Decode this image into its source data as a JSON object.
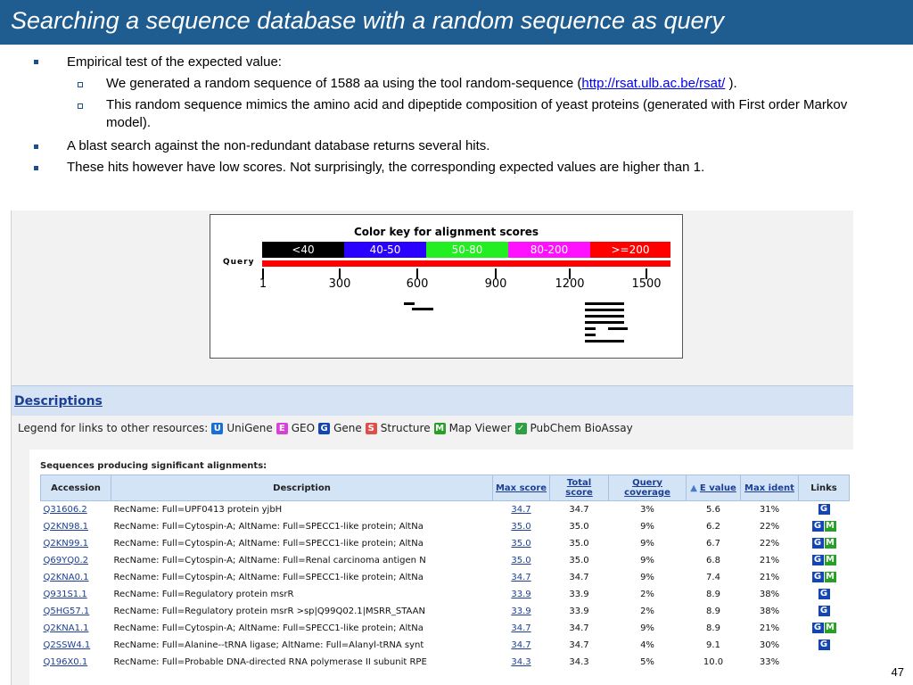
{
  "slide": {
    "title": "Searching a sequence database with a random sequence as query",
    "page_number": "47",
    "bullets": {
      "b1": "Empirical test of the expected value:",
      "b1a_prefix": "We generated a random sequence of 1588 aa using the tool random-sequence (",
      "b1a_link": "http://rsat.ulb.ac.be/rsat/",
      "b1a_suffix": " ).",
      "b1b": "This random sequence mimics the amino acid and dipeptide composition of yeast proteins (generated with First order Markov model).",
      "b2": "A blast search against the non-redundant database returns several hits.",
      "b3": "These hits however have low scores.  Not surprisingly, the corresponding expected values are higher than 1."
    }
  },
  "color_key": {
    "title": "Color key for alignment scores",
    "segments": [
      {
        "label": "<40",
        "color": "#000000"
      },
      {
        "label": "40-50",
        "color": "#2a00ff"
      },
      {
        "label": "50-80",
        "color": "#22ee22"
      },
      {
        "label": "80-200",
        "color": "#ff11ff"
      },
      {
        "label": ">=200",
        "color": "#ff0000"
      }
    ],
    "query_label": "Query",
    "ticks": [
      "1",
      "300",
      "600",
      "900",
      "1200",
      "1500"
    ]
  },
  "blast": {
    "descriptions_title": "Descriptions",
    "legend_prefix": "Legend for links to other resources:",
    "legend_items": [
      {
        "icon": "U",
        "label": "UniGene",
        "color": "#1a6fd6"
      },
      {
        "icon": "E",
        "label": "GEO",
        "color": "#d940d9"
      },
      {
        "icon": "G",
        "label": "Gene",
        "color": "#1346b4"
      },
      {
        "icon": "S",
        "label": "Structure",
        "color": "#e0504a"
      },
      {
        "icon": "M",
        "label": "Map Viewer",
        "color": "#28a028"
      },
      {
        "icon": "✓",
        "label": "PubChem BioAssay",
        "color": "#2f9e44"
      }
    ],
    "sequences_header": "Sequences producing significant alignments:",
    "columns": {
      "accession": "Accession",
      "description": "Description",
      "max_score": "Max score",
      "total_score": "Total score",
      "query_coverage": "Query coverage",
      "e_value": "E value",
      "max_ident": "Max ident",
      "links": "Links"
    },
    "rows": [
      {
        "acc": "Q31606.2",
        "desc": "RecName: Full=UPF0413 protein yjbH",
        "max": "34.7",
        "total": "34.7",
        "cov": "3%",
        "e": "5.6",
        "ident": "31%",
        "links": [
          "G"
        ]
      },
      {
        "acc": "Q2KN98.1",
        "desc": "RecName: Full=Cytospin-A; AltName: Full=SPECC1-like protein; AltNa",
        "max": "35.0",
        "total": "35.0",
        "cov": "9%",
        "e": "6.2",
        "ident": "22%",
        "links": [
          "G",
          "M"
        ]
      },
      {
        "acc": "Q2KN99.1",
        "desc": "RecName: Full=Cytospin-A; AltName: Full=SPECC1-like protein; AltNa",
        "max": "35.0",
        "total": "35.0",
        "cov": "9%",
        "e": "6.7",
        "ident": "22%",
        "links": [
          "G",
          "M"
        ]
      },
      {
        "acc": "Q69YQ0.2",
        "desc": "RecName: Full=Cytospin-A; AltName: Full=Renal carcinoma antigen N",
        "max": "35.0",
        "total": "35.0",
        "cov": "9%",
        "e": "6.8",
        "ident": "21%",
        "links": [
          "G",
          "M"
        ]
      },
      {
        "acc": "Q2KNA0.1",
        "desc": "RecName: Full=Cytospin-A; AltName: Full=SPECC1-like protein; AltNa",
        "max": "34.7",
        "total": "34.7",
        "cov": "9%",
        "e": "7.4",
        "ident": "21%",
        "links": [
          "G",
          "M"
        ]
      },
      {
        "acc": "Q931S1.1",
        "desc": "RecName: Full=Regulatory protein msrR",
        "max": "33.9",
        "total": "33.9",
        "cov": "2%",
        "e": "8.9",
        "ident": "38%",
        "links": [
          "G"
        ]
      },
      {
        "acc": "Q5HG57.1",
        "desc": "RecName: Full=Regulatory protein msrR >sp|Q99Q02.1|MSRR_STAAN",
        "max": "33.9",
        "total": "33.9",
        "cov": "2%",
        "e": "8.9",
        "ident": "38%",
        "links": [
          "G"
        ]
      },
      {
        "acc": "Q2KNA1.1",
        "desc": "RecName: Full=Cytospin-A; AltName: Full=SPECC1-like protein; AltNa",
        "max": "34.7",
        "total": "34.7",
        "cov": "9%",
        "e": "8.9",
        "ident": "21%",
        "links": [
          "G",
          "M"
        ]
      },
      {
        "acc": "Q2SSW4.1",
        "desc": "RecName: Full=Alanine--tRNA ligase; AltName: Full=Alanyl-tRNA synt",
        "max": "34.7",
        "total": "34.7",
        "cov": "4%",
        "e": "9.1",
        "ident": "30%",
        "links": [
          "G"
        ]
      },
      {
        "acc": "Q196X0.1",
        "desc": "RecName: Full=Probable DNA-directed RNA polymerase II subunit RPE",
        "max": "34.3",
        "total": "34.3",
        "cov": "5%",
        "e": "10.0",
        "ident": "33%",
        "links": []
      }
    ]
  }
}
